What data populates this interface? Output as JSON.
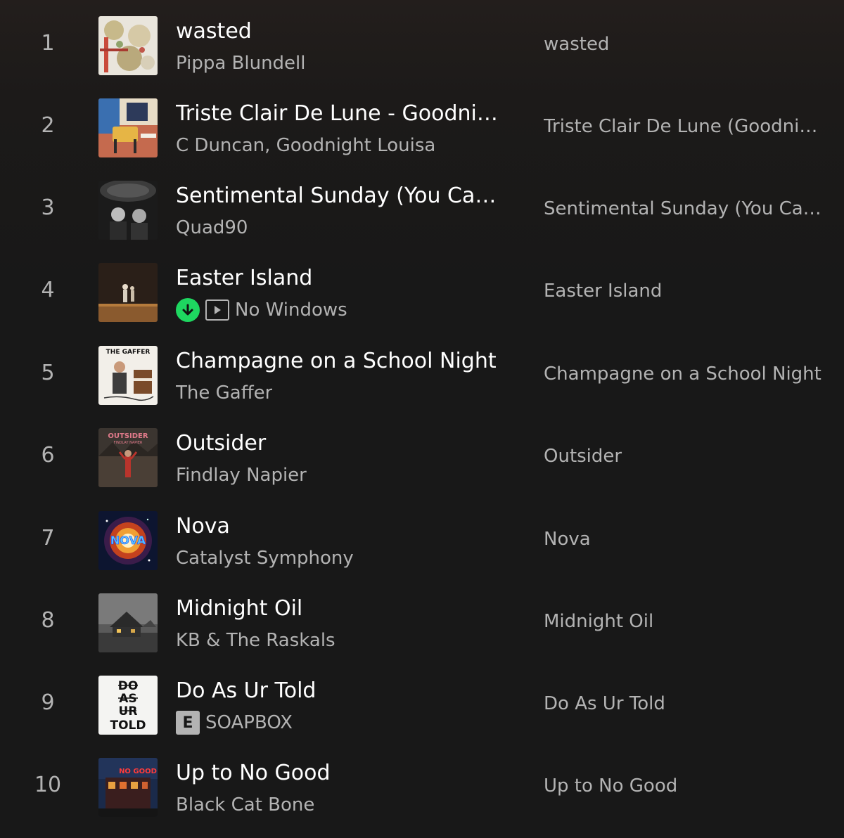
{
  "tracks": [
    {
      "number": "1",
      "title": "wasted",
      "artist": "Pippa Blundell",
      "album": "wasted",
      "art": "cover-art-wasted"
    },
    {
      "number": "2",
      "title": "Triste Clair De Lune - Goodnight Louisa",
      "artist": "C Duncan, Goodnight Louisa",
      "album": "Triste Clair De Lune (Goodnight Louisa)",
      "art": "cover-art-triste-clair-de-lune"
    },
    {
      "number": "3",
      "title": "Sentimental Sunday (You Can't Hurry Love)",
      "artist": "Quad90",
      "album": "Sentimental Sunday (You Can't Hurry Love)",
      "art": "cover-art-sentimental-sunday"
    },
    {
      "number": "4",
      "title": "Easter Island",
      "artist": "No Windows",
      "album": "Easter Island",
      "downloaded": true,
      "video": true,
      "art": "cover-art-easter-island"
    },
    {
      "number": "5",
      "title": "Champagne on a School Night",
      "artist": "The Gaffer",
      "album": "Champagne on a School Night",
      "art": "cover-art-champagne"
    },
    {
      "number": "6",
      "title": "Outsider",
      "artist": "Findlay Napier",
      "album": "Outsider",
      "art": "cover-art-outsider"
    },
    {
      "number": "7",
      "title": "Nova",
      "artist": "Catalyst Symphony",
      "album": "Nova",
      "art": "cover-art-nova"
    },
    {
      "number": "8",
      "title": "Midnight Oil",
      "artist": "KB & The Raskals",
      "album": "Midnight Oil",
      "art": "cover-art-midnight-oil"
    },
    {
      "number": "9",
      "title": "Do As Ur Told",
      "artist": "SOAPBOX",
      "album": "Do As Ur Told",
      "explicit": "E",
      "art": "cover-art-do-as-ur-told"
    },
    {
      "number": "10",
      "title": "Up to No Good",
      "artist": "Black Cat Bone",
      "album": "Up to No Good",
      "art": "cover-art-up-to-no-good"
    }
  ],
  "cover_text": {
    "the_gaffer": "THE GAFFER",
    "outsider": "OUTSIDER",
    "findlay_napier": "FINDLAY NAPIER",
    "nova": "NOVA",
    "do_as_ur_told": [
      "DO",
      "AS",
      "UR",
      "TOLD"
    ],
    "no_good": "NO GOOD"
  },
  "icons": {
    "downloaded": "download-arrow-icon",
    "video": "video-play-icon"
  },
  "colors": {
    "background": "#181818",
    "primary_text": "#ffffff",
    "secondary_text": "#b3b3b3",
    "download_green": "#1ed760"
  }
}
